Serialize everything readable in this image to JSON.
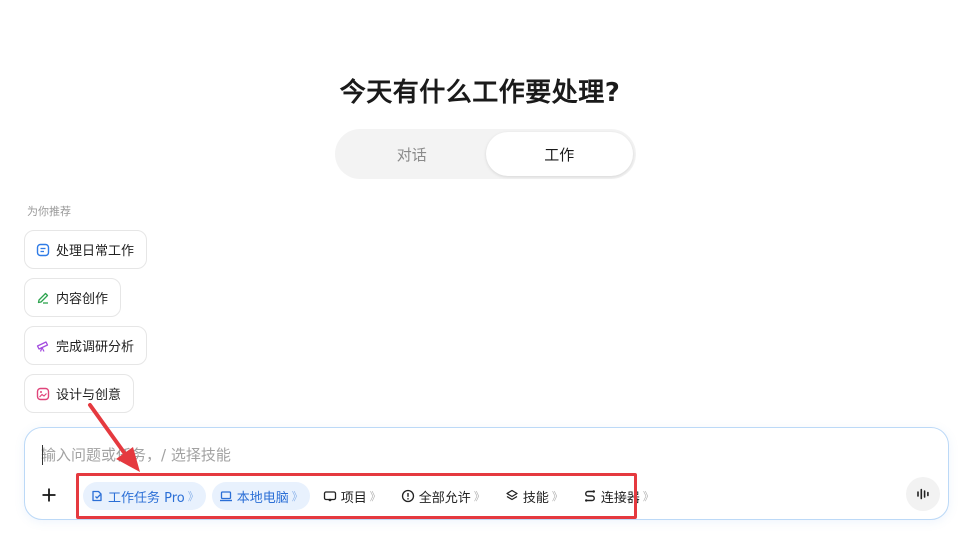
{
  "title": "今天有什么工作要处理?",
  "mode_tabs": [
    {
      "label": "对话",
      "active": false
    },
    {
      "label": "工作",
      "active": true
    }
  ],
  "recommend_label": "为你推荐",
  "suggestions": [
    {
      "label": "处理日常工作",
      "icon": "document-list-icon",
      "color": "#2f7be6"
    },
    {
      "label": "内容创作",
      "icon": "pen-icon",
      "color": "#2ea44f"
    },
    {
      "label": "完成调研分析",
      "icon": "telescope-icon",
      "color": "#a44ee0"
    },
    {
      "label": "设计与创意",
      "icon": "image-icon",
      "color": "#e0457b"
    }
  ],
  "composer": {
    "placeholder": "输入问题或任务，/ 选择技能"
  },
  "toolbar": [
    {
      "label": "工作任务 Pro",
      "icon": "task-icon",
      "highlighted": true
    },
    {
      "label": "本地电脑",
      "icon": "laptop-icon",
      "highlighted": true
    },
    {
      "label": "项目",
      "icon": "project-icon",
      "highlighted": false
    },
    {
      "label": "全部允许",
      "icon": "alert-circle-icon",
      "highlighted": false
    },
    {
      "label": "技能",
      "icon": "layers-icon",
      "highlighted": false
    },
    {
      "label": "连接器",
      "icon": "connector-icon",
      "highlighted": false
    }
  ],
  "chevron": "》",
  "colors": {
    "accent": "#2b6fd6",
    "annotation": "#e5393f"
  }
}
